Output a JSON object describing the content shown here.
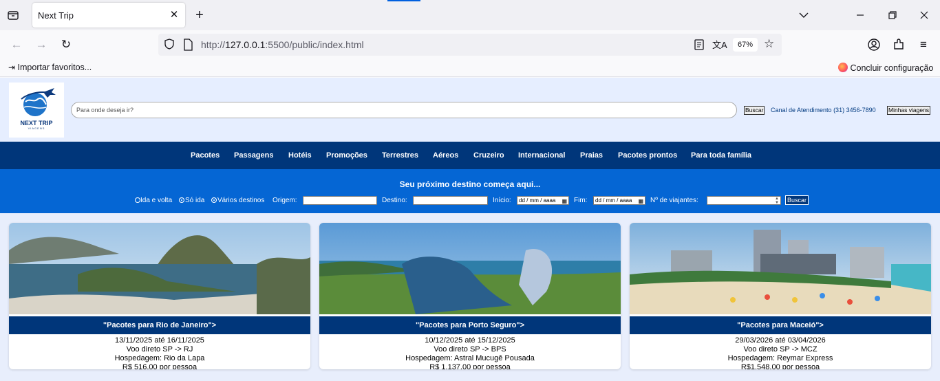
{
  "browser": {
    "tab_title": "Next Trip",
    "url_prefix": "http://",
    "url_host": "127.0.0.1",
    "url_path": ":5500/public/index.html",
    "zoom": "67%",
    "bookmark_import": "Importar favoritos...",
    "bookmark_setup": "Concluir configuração"
  },
  "header": {
    "logo_text": "NEXT TRIP",
    "logo_sub": "VIAGENS",
    "search_placeholder": "Para onde deseja ir?",
    "search_button": "Buscar",
    "support": "Canal de Atendimento (31) 3456-7890",
    "my_trips_button": "Minhas viagens"
  },
  "menu": [
    "Pacotes",
    "Passagens",
    "Hotéis",
    "Promoções",
    "Terrestres",
    "Aéreos",
    "Cruzeiro",
    "Internacional",
    "Praias",
    "Pacotes prontos",
    "Para toda família"
  ],
  "search_band": {
    "title": "Seu próximo destino começa aqui...",
    "trip_types": [
      "Ida e volta",
      "Só ida",
      "Vários destinos"
    ],
    "origin_label": "Origem:",
    "destination_label": "Destino:",
    "start_label": "Início:",
    "end_label": "Fim:",
    "date_placeholder": "dd / mm / aaaa",
    "travelers_label": "Nº de viajantes:",
    "button": "Buscar"
  },
  "cards": [
    {
      "title": "\"Pacotes para Rio de Janeiro\">",
      "dates": "13/11/2025 até 16/11/2025",
      "flight": "Voo direto SP -> RJ",
      "hotel": "Hospedagem: Rio da Lapa",
      "price": "R$ 516,00 por pessoa"
    },
    {
      "title": "\"Pacotes para Porto Seguro\">",
      "dates": "10/12/2025 até 15/12/2025",
      "flight": "Voo direto SP -> BPS",
      "hotel": "Hospedagem: Astral Mucugê Pousada",
      "price": "R$ 1.137,00 por pessoa"
    },
    {
      "title": "\"Pacotes para Maceió\">",
      "dates": "29/03/2026 até 03/04/2026",
      "flight": "Voo direto SP -> MCZ",
      "hotel": "Hospedagem: Reymar Express",
      "price": "R$1.548,00 por pessoa"
    }
  ],
  "colors": {
    "navy": "#00367a",
    "blue": "#0566d4",
    "header_bg": "#e6eeff"
  }
}
